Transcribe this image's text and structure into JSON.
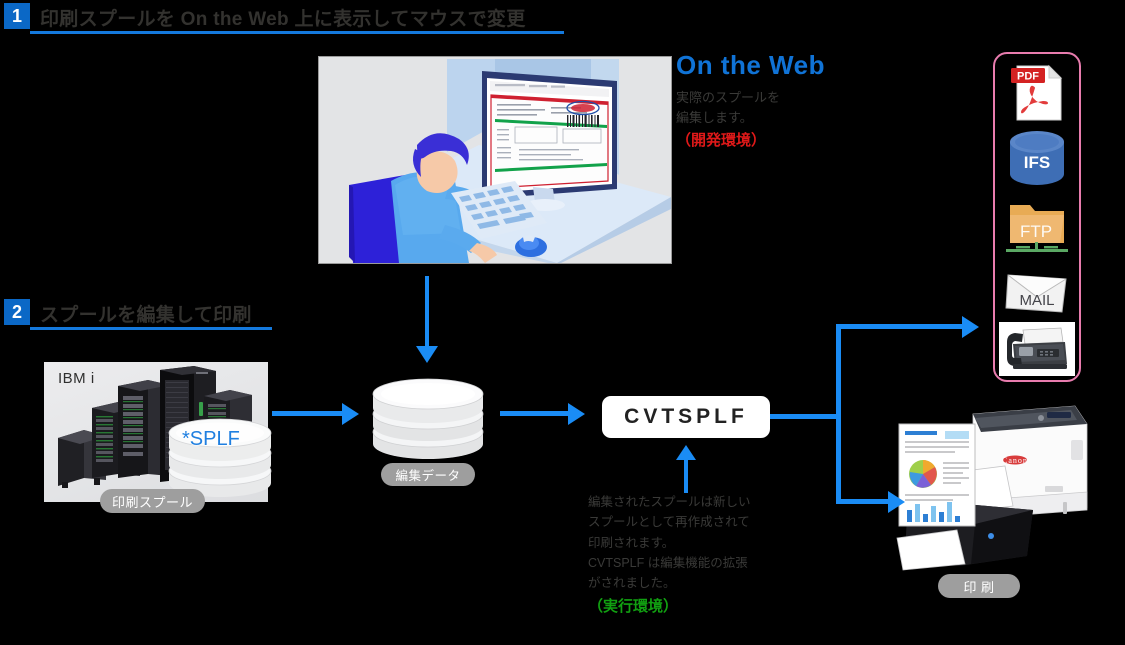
{
  "sections": [
    {
      "number": "1",
      "title": "印刷スプールを On the Web 上に表示してマウスで変更"
    },
    {
      "number": "2",
      "title": "スプールを編集して印刷"
    }
  ],
  "on_the_web": {
    "title": "On the Web",
    "body_line1": "実際のスプールを",
    "body_line2": "編集します。",
    "environment": "（開発環境）"
  },
  "description": {
    "line1": "編集されたスプールは新しい",
    "line2": "スプールとして再作成されて",
    "line3": "印刷されます。",
    "line4": "CVTSPLF は編集機能の拡張",
    "line5": "がされました。",
    "environment": "（実行環境）"
  },
  "ibm_panel": {
    "label": "IBM i",
    "disk_label": "*SPLF",
    "badge": "印刷スプール"
  },
  "edit_data": {
    "badge": "編集データ"
  },
  "command": {
    "label": "CVTSPLF"
  },
  "print": {
    "badge": "印 刷"
  },
  "outputs": [
    {
      "name": "pdf-icon",
      "label": "PDF"
    },
    {
      "name": "ifs-icon",
      "label": "IFS"
    },
    {
      "name": "ftp-icon",
      "label": "FTP"
    },
    {
      "name": "mail-icon",
      "label": "MAIL"
    },
    {
      "name": "fax-icon",
      "label": ""
    }
  ],
  "colors": {
    "accent_blue": "#1a8cf5",
    "header_blue": "#0b68c6",
    "rule_blue": "#1479dd",
    "dev_red": "#e01919",
    "run_green": "#11a011",
    "panel_pink": "#e87cae",
    "badge_gray": "#9e9e9e"
  },
  "icons": {
    "arrow_right": "arrow-right-icon",
    "arrow_down": "arrow-down-icon",
    "arrow_up": "arrow-up-icon"
  }
}
